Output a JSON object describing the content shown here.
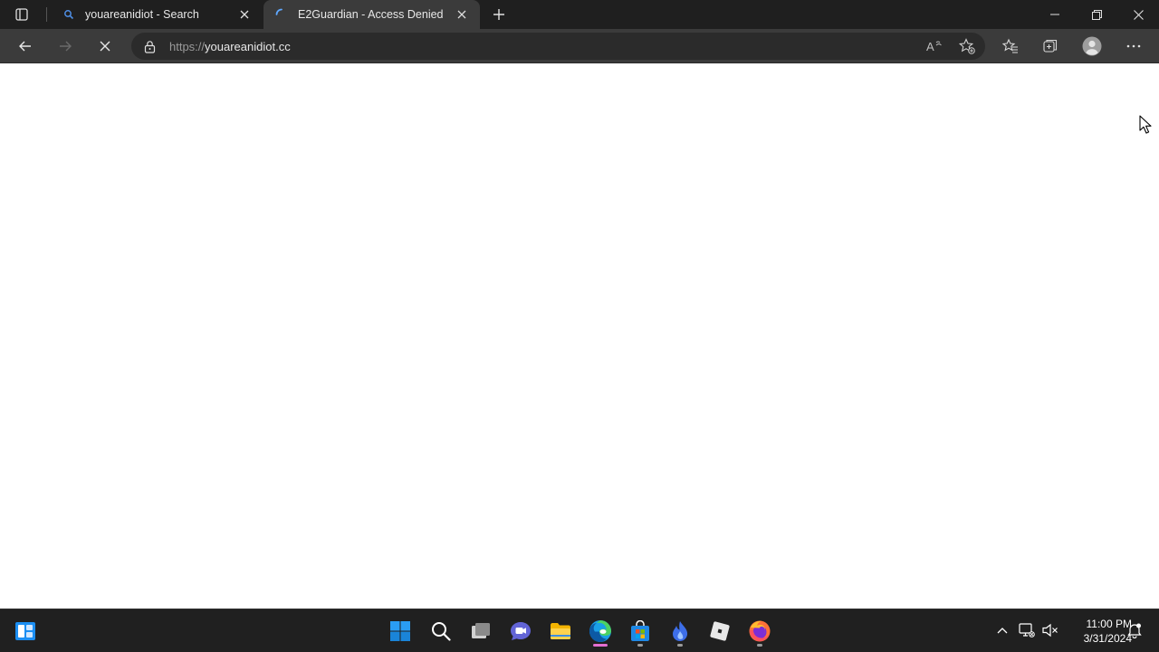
{
  "browser": {
    "tabs": [
      {
        "title": "youareanidiot - Search",
        "active": false,
        "icon": "search-favicon"
      },
      {
        "title": "E2Guardian - Access Denied",
        "active": true,
        "icon": "loading-spinner"
      }
    ],
    "address": {
      "scheme": "https://",
      "host": "youareanidiot.cc"
    },
    "toolbar_icons": [
      "back-arrow-icon",
      "forward-arrow-icon",
      "stop-loading-icon",
      "lock-icon",
      "read-aloud-icon",
      "add-favorite-icon",
      "favorites-icon",
      "collections-icon",
      "profile-icon",
      "more-icon"
    ],
    "window_controls": [
      "minimize-icon",
      "restore-icon",
      "close-icon"
    ]
  },
  "taskbar": {
    "apps": [
      "widgets",
      "start",
      "search",
      "task-view",
      "teams-chat",
      "file-explorer",
      "edge",
      "microsoft-store",
      "app-blue",
      "roblox",
      "firefox"
    ],
    "clock": {
      "time": "11:00 PM",
      "date": "3/31/2024"
    },
    "colors": {
      "accent": "#0078d4",
      "active_indicator": "#e36fd0"
    }
  }
}
